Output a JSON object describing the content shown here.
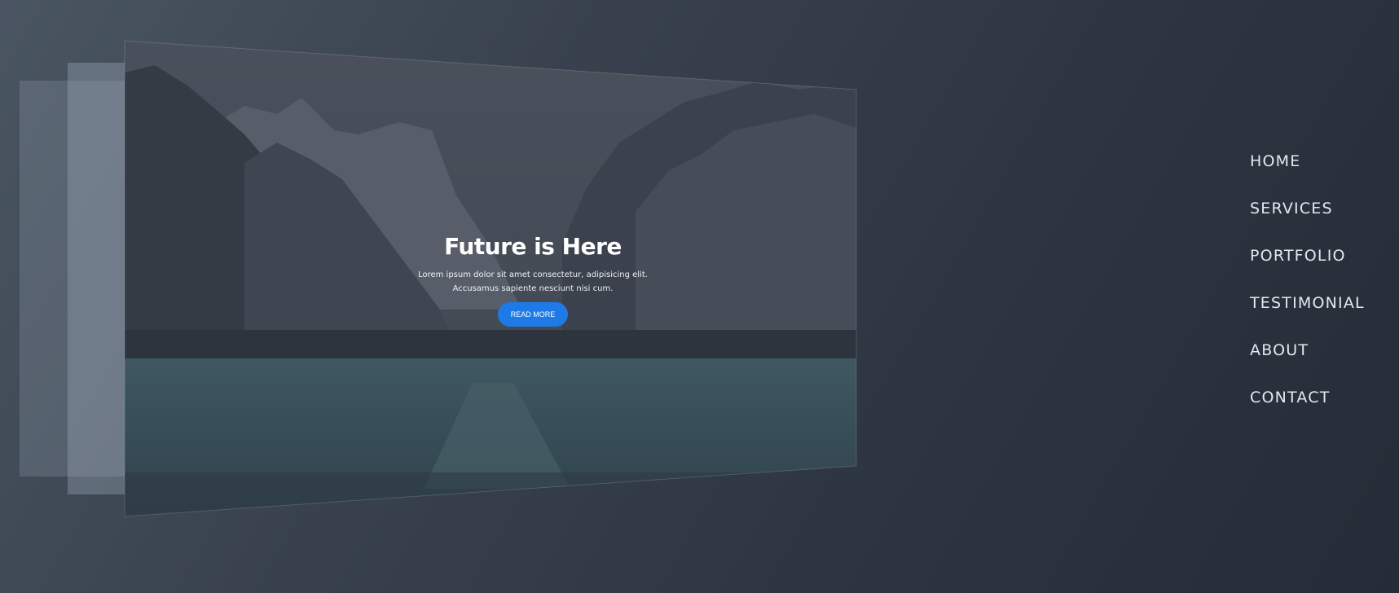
{
  "hero": {
    "title": "Future is Here",
    "text_line1": "Lorem ipsum dolor sit amet consectetur, adipisicing elit.",
    "text_line2": "Accusamus sapiente nesciunt nisi cum.",
    "button_label": "READ MORE"
  },
  "nav": {
    "items": [
      {
        "label": "HOME"
      },
      {
        "label": "SERVICES"
      },
      {
        "label": "PORTFOLIO"
      },
      {
        "label": "TESTIMONIAL"
      },
      {
        "label": "ABOUT"
      },
      {
        "label": "CONTACT"
      }
    ]
  },
  "colors": {
    "background": "#38414d",
    "accent": "#1e7ae6",
    "nav_text": "#e3e8ee",
    "lake": "#3c5a63"
  }
}
